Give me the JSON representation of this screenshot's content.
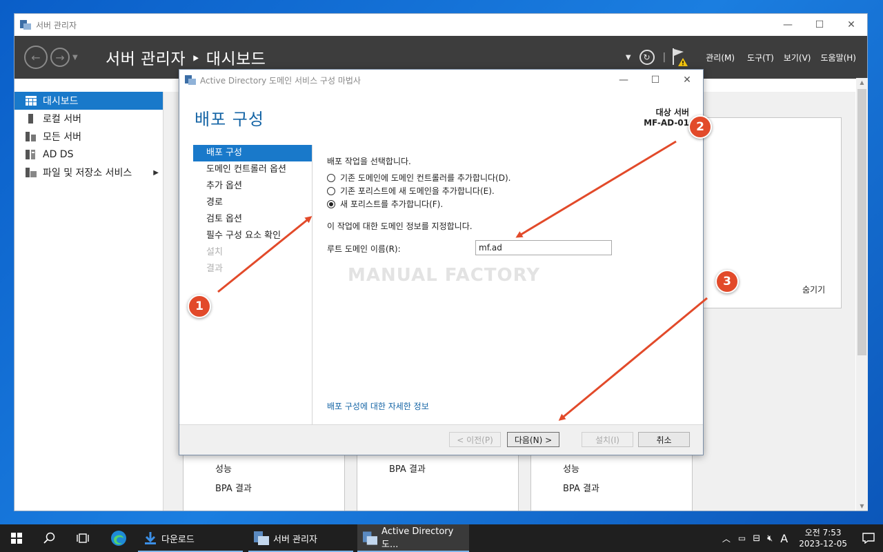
{
  "sm_window": {
    "title": "서버 관리자",
    "header_title": "서버 관리자 ‣ 대시보드",
    "menus": [
      "관리(M)",
      "도구(T)",
      "보기(V)",
      "도움말(H)"
    ]
  },
  "sidebar": {
    "items": [
      {
        "label": "대시보드",
        "icon": "dashboard-icon"
      },
      {
        "label": "로컬 서버",
        "icon": "server-icon"
      },
      {
        "label": "모든 서버",
        "icon": "servers-icon"
      },
      {
        "label": "AD DS",
        "icon": "ad-ds-icon"
      },
      {
        "label": "파일 및 저장소 서비스",
        "icon": "storage-icon"
      }
    ]
  },
  "welcome": {
    "hide_label": "숨기기"
  },
  "tiles": [
    {
      "line1": "성능",
      "line2": "BPA 결과"
    },
    {
      "line1": "",
      "line2": "BPA 결과"
    },
    {
      "line1": "성능",
      "line2": "BPA 결과"
    }
  ],
  "dialog": {
    "title": "Active Directory 도메인 서비스 구성 마법사",
    "heading": "배포 구성",
    "target_label": "대상 서버",
    "target_value": "MF-AD-01",
    "steps": [
      {
        "label": "배포 구성",
        "state": "active"
      },
      {
        "label": "도메인 컨트롤러 옵션",
        "state": "normal"
      },
      {
        "label": "추가 옵션",
        "state": "normal"
      },
      {
        "label": "경로",
        "state": "normal"
      },
      {
        "label": "검토 옵션",
        "state": "normal"
      },
      {
        "label": "필수 구성 요소 확인",
        "state": "normal"
      },
      {
        "label": "설치",
        "state": "disabled"
      },
      {
        "label": "결과",
        "state": "disabled"
      }
    ],
    "select_op_label": "배포 작업을 선택합니다.",
    "radios": [
      {
        "label": "기존 도메인에 도메인 컨트롤러를 추가합니다(D).",
        "checked": false
      },
      {
        "label": "기존 포리스트에 새 도메인을 추가합니다(E).",
        "checked": false
      },
      {
        "label": "새 포리스트를 추가합니다(F).",
        "checked": true
      }
    ],
    "domain_info_label": "이 작업에 대한 도메인 정보를 지정합니다.",
    "root_domain_label": "루트 도메인 이름(R):",
    "root_domain_value": "mf.ad",
    "watermark": "MANUAL FACTORY",
    "more_info_link": "배포 구성에 대한 자세한 정보",
    "buttons": {
      "prev": "< 이전(P)",
      "next": "다음(N) >",
      "install": "설치(I)",
      "cancel": "취소"
    }
  },
  "annotations": {
    "badges": [
      "1",
      "2",
      "3"
    ],
    "color": "#e24a2a"
  },
  "taskbar": {
    "items": [
      {
        "label": "다운로드",
        "icon": "download-icon"
      },
      {
        "label": "서버 관리자",
        "icon": "server-manager-icon"
      },
      {
        "label": "Active Directory 도...",
        "icon": "server-manager-icon"
      }
    ],
    "ime": "A",
    "time": "오전 7:53",
    "date": "2023-12-05"
  }
}
